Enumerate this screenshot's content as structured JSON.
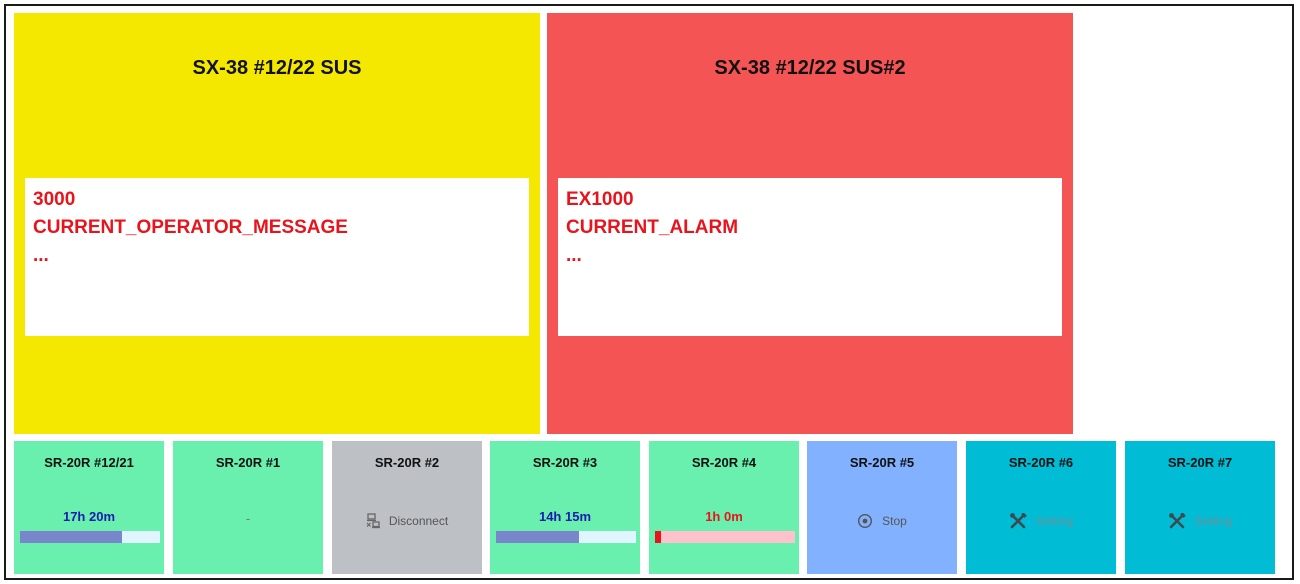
{
  "colors": {
    "yellow_panel": "#f5e800",
    "red_panel": "#f55454",
    "message_text": "#e8141c",
    "green_tile": "#69f0ae",
    "gray_tile": "#bdc1c6",
    "blue_tile": "#82b1ff",
    "teal_tile": "#00bcd4",
    "progress_fill": "#7986cb",
    "progress_track": "#e1f5fe",
    "alarm_fill": "#e8141c",
    "alarm_track": "#ffc1cc",
    "time_text": "#1a1ab0",
    "alarm_text": "#e8141c"
  },
  "machines_main": [
    {
      "title": "SX-38 #12/22 SUS",
      "code": "3000",
      "message": "CURRENT_OPERATOR_MESSAGE",
      "ellipsis": "..."
    },
    {
      "title": "SX-38 #12/22 SUS#2",
      "code": "EX1000",
      "message": "CURRENT_ALARM",
      "ellipsis": "..."
    }
  ],
  "machines_small": [
    {
      "name": "SR-20R #12/21",
      "value": "17h 20m",
      "progress": 0.73
    },
    {
      "name": "SR-20R #1",
      "value": "-"
    },
    {
      "name": "SR-20R #2",
      "status": "Disconnect",
      "icon": "disconnect-icon"
    },
    {
      "name": "SR-20R #3",
      "value": "14h 15m",
      "progress": 0.59
    },
    {
      "name": "SR-20R #4",
      "value": "1h 0m",
      "progress": 0.04
    },
    {
      "name": "SR-20R #5",
      "status": "Stop",
      "icon": "stop-icon"
    },
    {
      "name": "SR-20R #6",
      "status": "Setting",
      "icon": "tools-icon"
    },
    {
      "name": "SR-20R #7",
      "status": "Setting",
      "icon": "tools-icon"
    }
  ]
}
